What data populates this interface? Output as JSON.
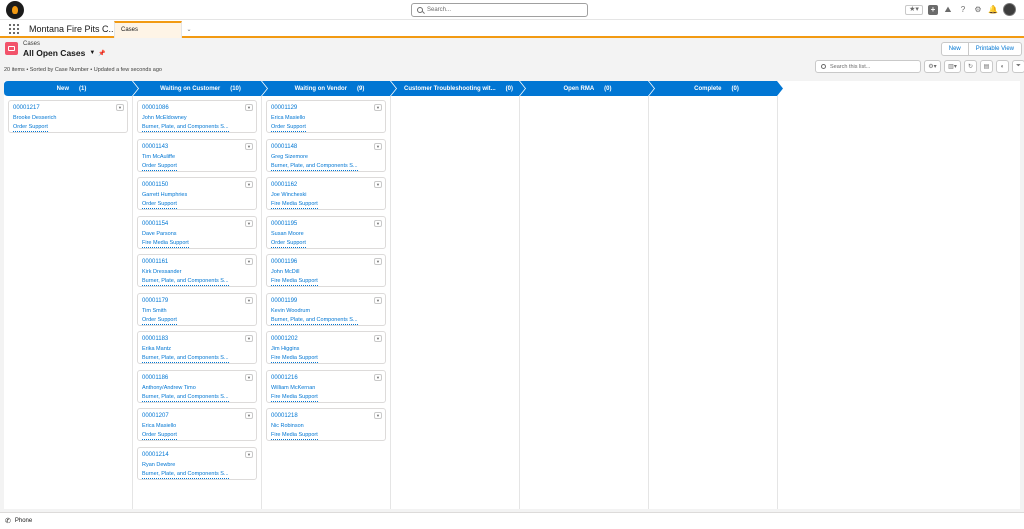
{
  "header": {
    "search_placeholder": "Search..."
  },
  "nav": {
    "app_name": "Montana Fire Pits C...",
    "tab_label": "Cases"
  },
  "list": {
    "object_label": "Cases",
    "title": "All Open Cases",
    "meta": "20 items • Sorted by Case Number • Updated a few seconds ago",
    "new_button": "New",
    "printable_button": "Printable View",
    "search_placeholder": "Search this list..."
  },
  "stages": [
    {
      "name": "New",
      "count": "(1)"
    },
    {
      "name": "Waiting on Customer",
      "count": "(10)"
    },
    {
      "name": "Waiting on Vendor",
      "count": "(9)"
    },
    {
      "name": "Customer Troubleshooting wit...",
      "count": "(0)"
    },
    {
      "name": "Open RMA",
      "count": "(0)"
    },
    {
      "name": "Complete",
      "count": "(0)"
    }
  ],
  "columns": [
    [
      {
        "number": "00001217",
        "name": "Brooke Desserich",
        "type": "Order Support"
      }
    ],
    [
      {
        "number": "00001086",
        "name": "John McEldowney",
        "type": "Burner, Plate, and Components S..."
      },
      {
        "number": "00001143",
        "name": "Tim McAuliffe",
        "type": "Order Support"
      },
      {
        "number": "00001150",
        "name": "Garrett Humphries",
        "type": "Order Support"
      },
      {
        "number": "00001154",
        "name": "Dave Parsons",
        "type": "Fire Media Support"
      },
      {
        "number": "00001161",
        "name": "Kirk Dressander",
        "type": "Burner, Plate, and Components S..."
      },
      {
        "number": "00001179",
        "name": "Tim Smith",
        "type": "Order Support"
      },
      {
        "number": "00001183",
        "name": "Erika Mantz",
        "type": "Burner, Plate, and Components S..."
      },
      {
        "number": "00001186",
        "name": "Anthony/Andrew Timo",
        "type": "Burner, Plate, and Components S..."
      },
      {
        "number": "00001207",
        "name": "Erica Masiello",
        "type": "Order Support"
      },
      {
        "number": "00001214",
        "name": "Ryan Dewbre",
        "type": "Burner, Plate, and Components S..."
      }
    ],
    [
      {
        "number": "00001129",
        "name": "Erica Masiello",
        "type": "Order Support"
      },
      {
        "number": "00001148",
        "name": "Greg Sizemore",
        "type": "Burner, Plate, and Components S..."
      },
      {
        "number": "00001162",
        "name": "Joe Wincheski",
        "type": "Fire Media Support"
      },
      {
        "number": "00001195",
        "name": "Susan Moore",
        "type": "Order Support"
      },
      {
        "number": "00001196",
        "name": "John McDill",
        "type": "Fire Media Support"
      },
      {
        "number": "00001199",
        "name": "Kevin Woodrum",
        "type": "Burner, Plate, and Components S..."
      },
      {
        "number": "00001202",
        "name": "Jim Higgins",
        "type": "Fire Media Support"
      },
      {
        "number": "00001216",
        "name": "William McKernan",
        "type": "Fire Media Support"
      },
      {
        "number": "00001218",
        "name": "Nic Robinson",
        "type": "Fire Media Support"
      }
    ],
    [],
    [],
    []
  ],
  "footer": {
    "phone_label": "Phone"
  },
  "colors": {
    "brand_blue": "#0176d3",
    "tab_accent": "#f29a12",
    "object_icon": "#f2536a"
  }
}
